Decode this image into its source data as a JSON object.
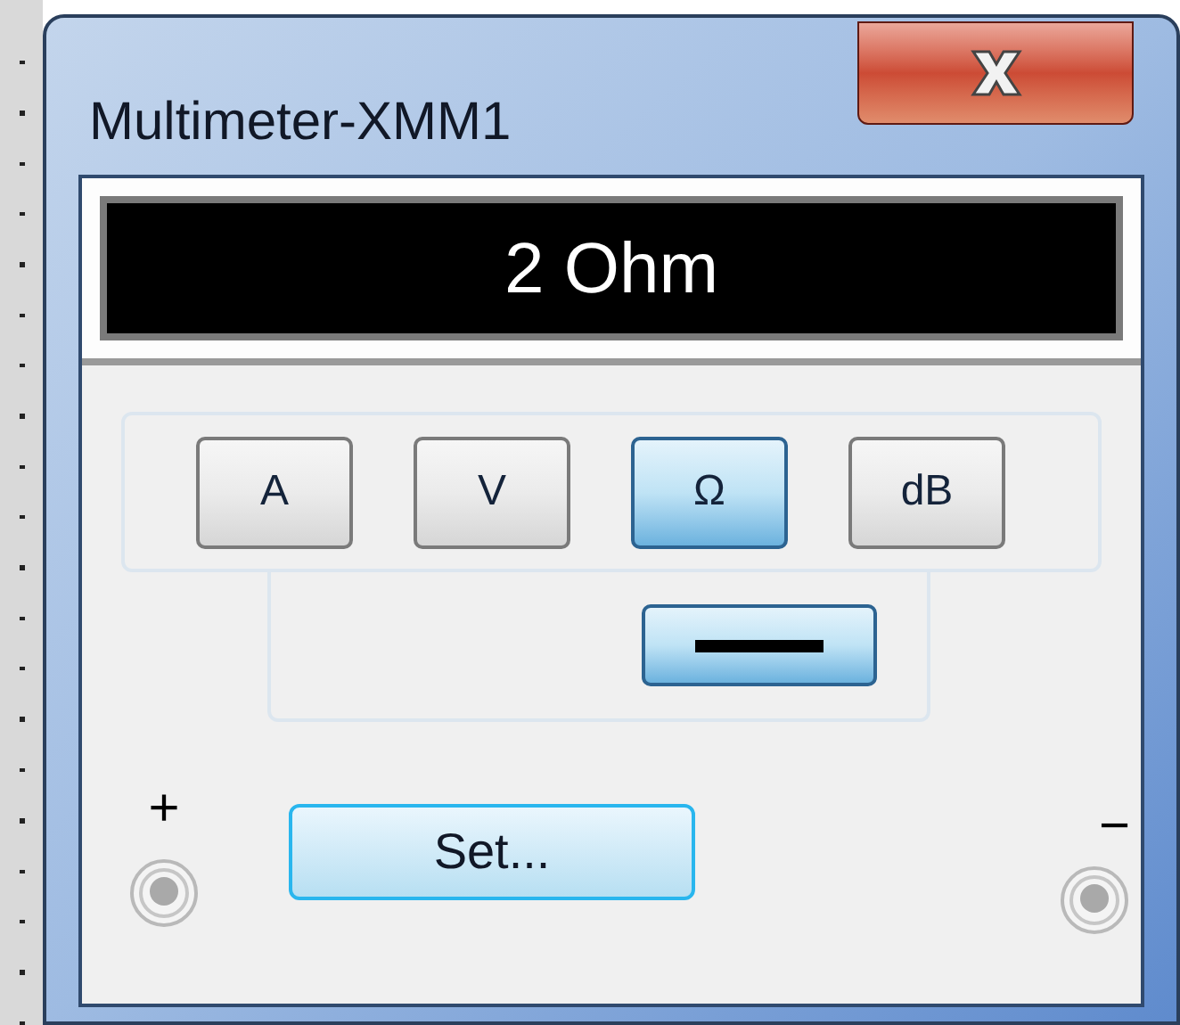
{
  "window": {
    "title": "Multimeter-XMM1"
  },
  "display": {
    "reading": "2 Ohm"
  },
  "modes": [
    {
      "label": "A",
      "selected": false
    },
    {
      "label": "V",
      "selected": false
    },
    {
      "label": "Ω",
      "selected": true
    },
    {
      "label": "dB",
      "selected": false
    }
  ],
  "coupling": {
    "kind": "dc",
    "selected": true
  },
  "set_button": {
    "label": "Set..."
  },
  "terminals": [
    {
      "label": "+"
    },
    {
      "label": "−"
    }
  ]
}
